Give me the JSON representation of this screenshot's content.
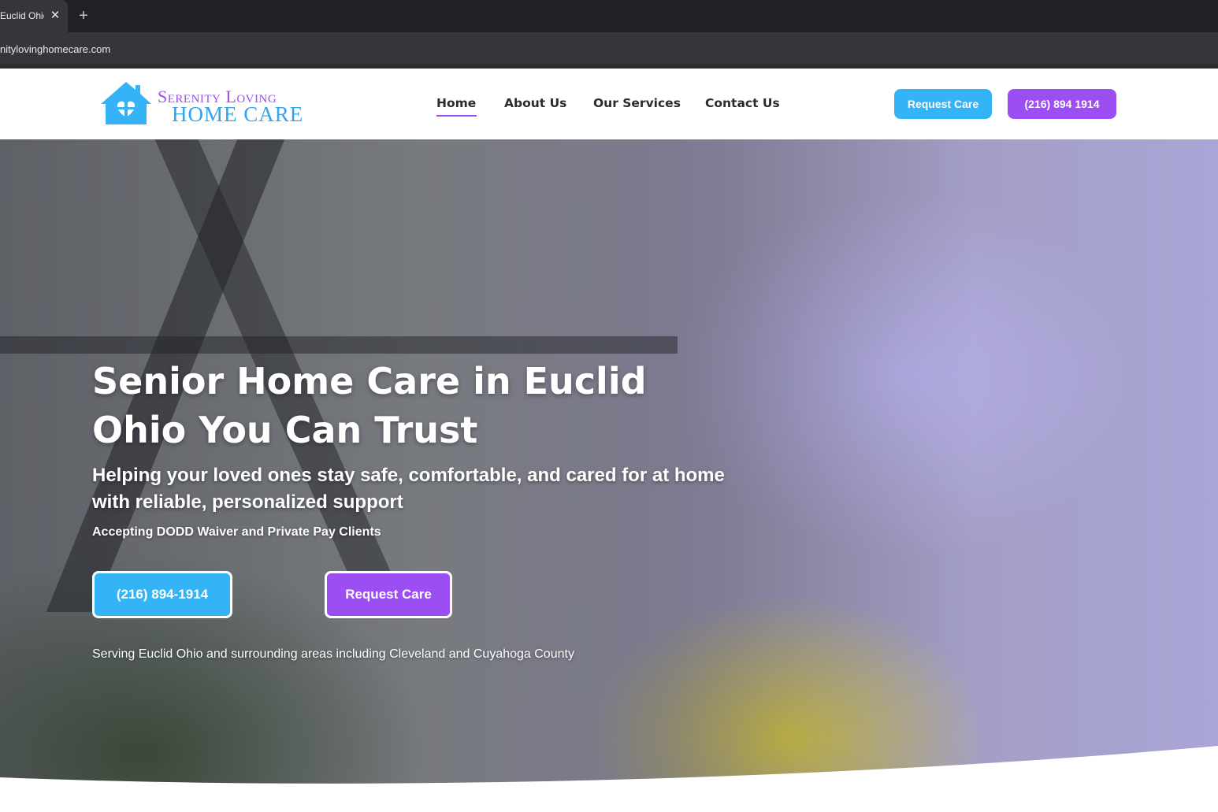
{
  "browser": {
    "tab_title": "Euclid Ohio",
    "tab_close": "✕",
    "new_tab": "+",
    "url": "nitylovinghomecare.com"
  },
  "site": {
    "logo": {
      "line1": "Serenity Loving",
      "line2": "HOME CARE"
    },
    "nav": {
      "home": "Home",
      "about": "About Us",
      "services": "Our Services",
      "contact": "Contact Us",
      "active": "Home"
    },
    "header_buttons": {
      "request": "Request Care",
      "phone": "(216) 894 1914"
    }
  },
  "hero": {
    "title": "Senior Home Care in Euclid Ohio You Can Trust",
    "subtitle": "Helping your loved ones stay safe, comfortable, and cared for at home with reliable, personalized support",
    "accepting": "Accepting DODD Waiver and Private Pay Clients",
    "phone_button": "(216) 894-1914",
    "request_button": "Request Care",
    "serving": "Serving Euclid Ohio and surrounding areas including Cleveland and Cuyahoga County"
  },
  "colors": {
    "purple": "#9b4ef2",
    "blue": "#34b3f6",
    "nav_text": "#2b2b2b"
  },
  "icons": {
    "logo": "house-heart-icon",
    "close": "close-icon",
    "new_tab": "plus-icon"
  }
}
